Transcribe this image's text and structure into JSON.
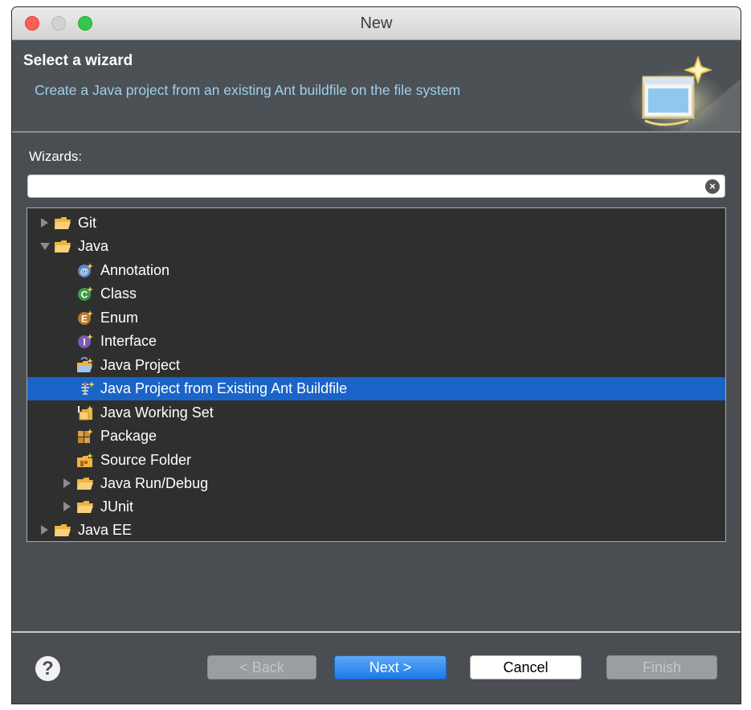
{
  "window": {
    "title": "New"
  },
  "header": {
    "title": "Select a wizard",
    "description": "Create a Java project from an existing Ant buildfile on the file system"
  },
  "wizards": {
    "label": "Wizards:",
    "search_value": "",
    "tree": [
      {
        "label": "Git",
        "icon": "folder-icon",
        "expander": "collapsed"
      },
      {
        "label": "Java",
        "icon": "folder-icon",
        "expander": "expanded"
      },
      {
        "label": "Annotation",
        "icon": "annotation-icon"
      },
      {
        "label": "Class",
        "icon": "class-icon"
      },
      {
        "label": "Enum",
        "icon": "enum-icon"
      },
      {
        "label": "Interface",
        "icon": "interface-icon"
      },
      {
        "label": "Java Project",
        "icon": "java-project-icon"
      },
      {
        "label": "Java Project from Existing Ant Buildfile",
        "icon": "ant-icon",
        "selected": true
      },
      {
        "label": "Java Working Set",
        "icon": "working-set-icon"
      },
      {
        "label": "Package",
        "icon": "package-icon"
      },
      {
        "label": "Source Folder",
        "icon": "source-folder-icon"
      },
      {
        "label": "Java Run/Debug",
        "icon": "folder-icon",
        "expander": "collapsed"
      },
      {
        "label": "JUnit",
        "icon": "folder-icon",
        "expander": "collapsed"
      },
      {
        "label": "Java EE",
        "icon": "folder-icon",
        "expander": "collapsed"
      }
    ]
  },
  "buttons": {
    "help": "?",
    "back": "< Back",
    "next": "Next >",
    "cancel": "Cancel",
    "finish": "Finish"
  },
  "colors": {
    "selection": "#1a64c7",
    "description_text": "#9fd0ea",
    "primary_button": "#1a7ae8"
  }
}
